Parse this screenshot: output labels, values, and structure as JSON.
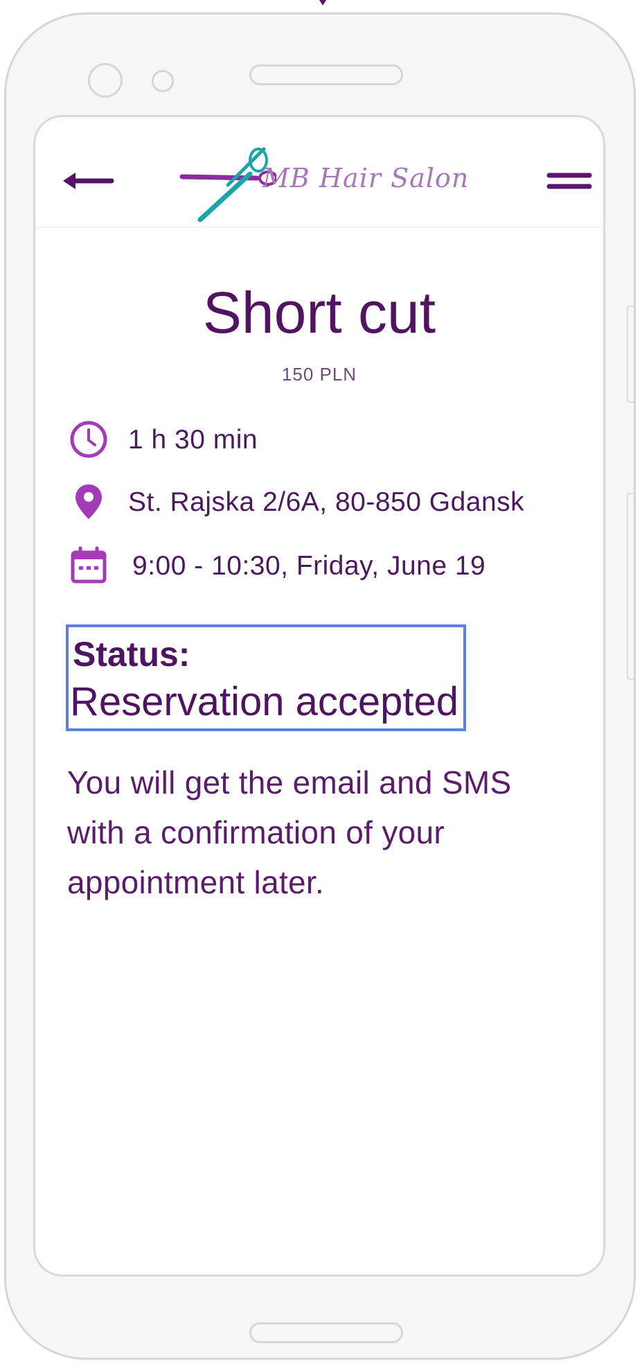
{
  "app": {
    "brand_name": "MB Hair Salon"
  },
  "header": {
    "back_icon": "arrow-left-icon",
    "menu_icon": "hamburger-menu-icon"
  },
  "service": {
    "title": "Short cut",
    "price": "150 PLN"
  },
  "details": {
    "duration": "1 h 30 min",
    "address": "St. Rajska 2/6A, 80-850 Gdansk",
    "datetime": "9:00 - 10:30, Friday, June 19"
  },
  "status": {
    "label": "Status:",
    "value": "Reservation accepted"
  },
  "confirmation_text": "You will get the email and SMS with a confirmation of your appointment later.",
  "colors": {
    "primary": "#531363",
    "accent": "#a23bb8",
    "logo_teal": "#19a6a6",
    "focus_border": "#5f7fdc"
  }
}
